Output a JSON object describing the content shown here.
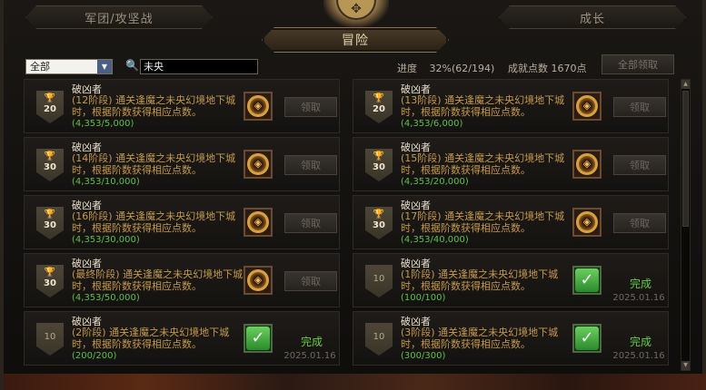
{
  "tabs": {
    "left": "军团/攻坚战",
    "active": "冒险",
    "right": "成长"
  },
  "filter": {
    "category_value": "全部",
    "search_value": "未央"
  },
  "stats": {
    "progress_label": "进度",
    "progress_pct": "32%",
    "progress_count": "(62/194)",
    "points_text": "成就点数 1670点",
    "claim_all_label": "全部领取"
  },
  "achievements": [
    {
      "title": "破凶者",
      "badge": "20",
      "trophy": true,
      "desc": "(12阶段) 通关逢魔之未央幻境地下城时，根据阶数获得相应点数。",
      "count": "(4,353/5,000)",
      "status": "领取",
      "date": ""
    },
    {
      "title": "破凶者",
      "badge": "20",
      "trophy": true,
      "desc": "(13阶段) 通关逢魔之未央幻境地下城时，根据阶数获得相应点数。",
      "count": "(4,353/6,000)",
      "status": "领取",
      "date": ""
    },
    {
      "title": "破凶者",
      "badge": "30",
      "trophy": true,
      "desc": "(14阶段) 通关逢魔之未央幻境地下城时，根据阶数获得相应点数。",
      "count": "(4,353/10,000)",
      "status": "领取",
      "date": ""
    },
    {
      "title": "破凶者",
      "badge": "30",
      "trophy": true,
      "desc": "(15阶段) 通关逢魔之未央幻境地下城时，根据阶数获得相应点数。",
      "count": "(4,353/20,000)",
      "status": "领取",
      "date": ""
    },
    {
      "title": "破凶者",
      "badge": "30",
      "trophy": true,
      "desc": "(16阶段) 通关逢魔之未央幻境地下城时，根据阶数获得相应点数。",
      "count": "(4,353/30,000)",
      "status": "领取",
      "date": ""
    },
    {
      "title": "破凶者",
      "badge": "30",
      "trophy": true,
      "desc": "(17阶段) 通关逢魔之未央幻境地下城时，根据阶数获得相应点数。",
      "count": "(4,353/40,000)",
      "status": "领取",
      "date": ""
    },
    {
      "title": "破凶者",
      "badge": "30",
      "trophy": true,
      "desc": "(最终阶段) 通关逢魔之未央幻境地下城时，根据阶数获得相应点数。",
      "count": "(4,353/50,000)",
      "status": "领取",
      "date": ""
    },
    {
      "title": "破凶者",
      "badge": "10",
      "trophy": false,
      "desc": "(1阶段) 通关逢魔之未央幻境地下城时，根据阶数获得相应点数。",
      "count": "(100/100)",
      "status": "完成",
      "date": "2025.01.16"
    },
    {
      "title": "破凶者",
      "badge": "10",
      "trophy": false,
      "desc": "(2阶段) 通关逢魔之未央幻境地下城时，根据阶数获得相应点数。",
      "count": "(200/200)",
      "status": "完成",
      "date": "2025.01.16"
    },
    {
      "title": "破凶者",
      "badge": "10",
      "trophy": false,
      "desc": "(3阶段) 通关逢魔之未央幻境地下城时，根据阶数获得相应点数。",
      "count": "(300/300)",
      "status": "完成",
      "date": "2025.01.16"
    }
  ]
}
